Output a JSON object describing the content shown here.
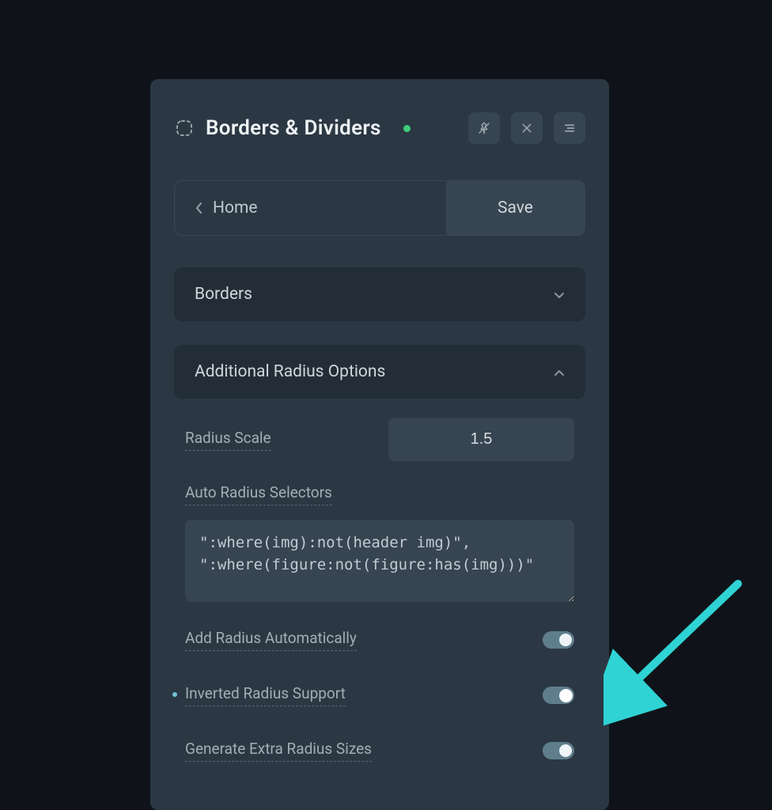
{
  "header": {
    "title": "Borders & Dividers",
    "status": "active"
  },
  "nav": {
    "back_label": "Home",
    "save_label": "Save"
  },
  "sections": {
    "borders": {
      "label": "Borders",
      "expanded": false
    },
    "additional_radius": {
      "label": "Additional Radius Options",
      "expanded": true
    }
  },
  "fields": {
    "radius_scale": {
      "label": "Radius Scale",
      "value": "1.5"
    },
    "auto_selectors": {
      "label": "Auto Radius Selectors",
      "value": "\":where(img):not(header img)\",\n\":where(figure:not(figure:has(img)))\""
    },
    "add_radius_auto": {
      "label": "Add Radius Automatically",
      "value": true
    },
    "inverted_radius": {
      "label": "Inverted Radius Support",
      "value": true,
      "highlighted": true
    },
    "extra_radius_sizes": {
      "label": "Generate Extra Radius Sizes",
      "value": true
    }
  }
}
